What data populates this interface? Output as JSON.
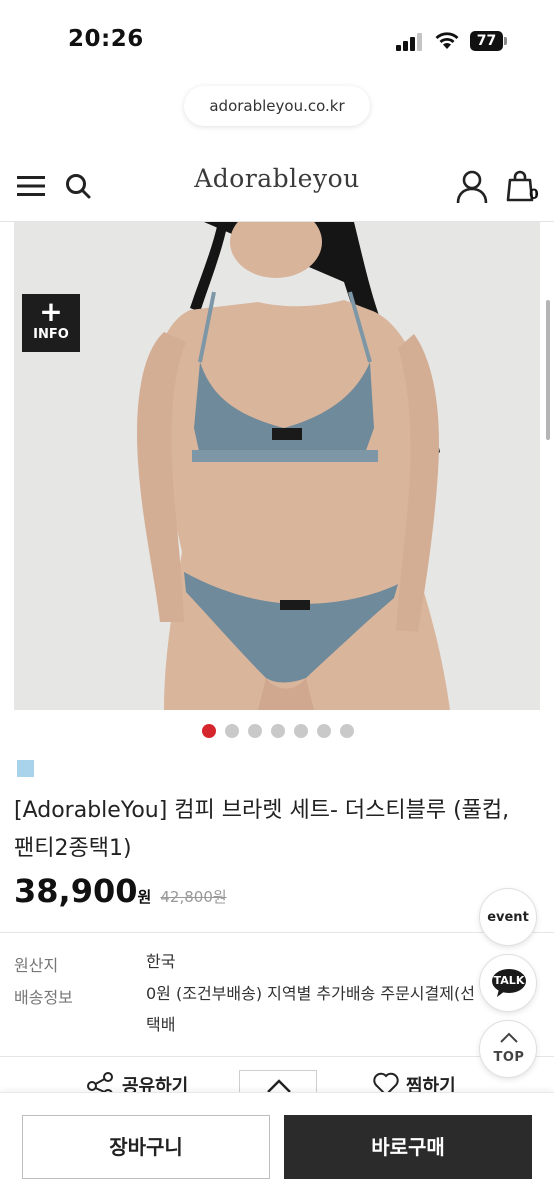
{
  "status_bar": {
    "time": "20:26",
    "battery": "77"
  },
  "browser": {
    "url": "adorableyou.co.kr"
  },
  "header": {
    "logo": "Adorableyou",
    "cart_count": "0",
    "icons": [
      "menu-icon",
      "search-icon",
      "user-icon",
      "shopping-bag-icon"
    ]
  },
  "gallery": {
    "info_plus": "+",
    "info_label": "INFO",
    "slide_count": 7,
    "active_slide": 0,
    "colors": {
      "active_dot": "#d4262c",
      "dot": "#c9c9c9"
    }
  },
  "product": {
    "swatch_color": "#a9d3ea",
    "title": "[AdorableYou] 컴피 브라렛 세트- 더스티블루 (풀컵,팬티2종택1)",
    "price": "38,900",
    "price_unit": "원",
    "original_price": "42,800원"
  },
  "details": [
    {
      "label": "원산지",
      "value": "한국"
    },
    {
      "label": "배송정보",
      "value": "0원 (조건부배송) 지역별 추가배송 주문시결제(선결제)",
      "value2": "택배"
    }
  ],
  "actions": {
    "share": "공유하기",
    "wish": "찜하기"
  },
  "floating": {
    "event": "event",
    "talk": "TALK",
    "top": "TOP"
  },
  "bottom_bar": {
    "cart": "장바구니",
    "buy": "바로구매",
    "buy_color": "#2b2b2b"
  }
}
